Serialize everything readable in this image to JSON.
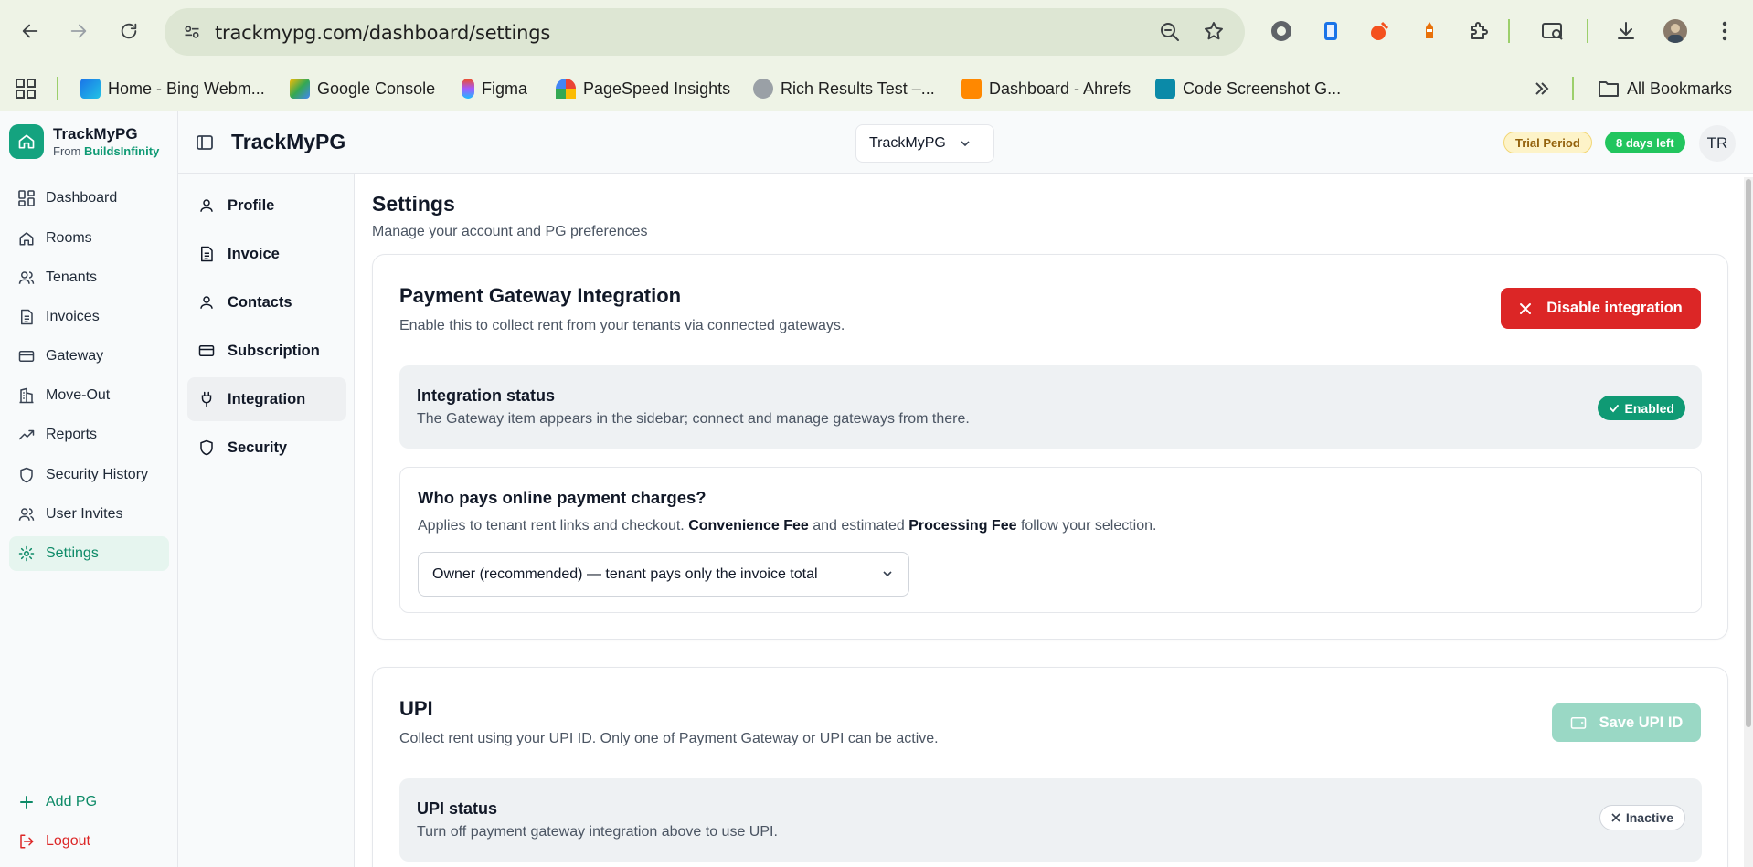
{
  "browser": {
    "url": "trackmypg.com/dashboard/settings",
    "bookmarks": [
      {
        "label": "Home - Bing Webm...",
        "color": "#1a73e8"
      },
      {
        "label": "Google Console",
        "color": "#fbbc04"
      },
      {
        "label": "Figma",
        "color": "#f24e1e"
      },
      {
        "label": "PageSpeed Insights",
        "color": "#4285f4"
      },
      {
        "label": "Rich Results Test –...",
        "color": "#5f6368"
      },
      {
        "label": "Dashboard - Ahrefs",
        "color": "#ff8800"
      },
      {
        "label": "Code Screenshot G...",
        "color": "#0b8aa8"
      }
    ],
    "all_bookmarks_label": "All Bookmarks"
  },
  "brand": {
    "name": "TrackMyPG",
    "from": "From",
    "company": "BuildsInfinity"
  },
  "sidebar": {
    "items": [
      {
        "label": "Dashboard",
        "icon": "grid-icon"
      },
      {
        "label": "Rooms",
        "icon": "home-icon"
      },
      {
        "label": "Tenants",
        "icon": "users-icon"
      },
      {
        "label": "Invoices",
        "icon": "file-icon"
      },
      {
        "label": "Gateway",
        "icon": "card-icon"
      },
      {
        "label": "Move-Out",
        "icon": "building-icon"
      },
      {
        "label": "Reports",
        "icon": "trend-icon"
      },
      {
        "label": "Security History",
        "icon": "shield-icon"
      },
      {
        "label": "User Invites",
        "icon": "users-icon"
      },
      {
        "label": "Settings",
        "icon": "gear-icon"
      }
    ],
    "add_pg": "Add PG",
    "logout": "Logout"
  },
  "topbar": {
    "title": "TrackMyPG",
    "pg_select": "TrackMyPG",
    "trial_badge": "Trial Period",
    "days_badge": "8 days left",
    "avatar": "TR"
  },
  "settings_nav": {
    "items": [
      {
        "label": "Profile",
        "icon": "user-icon"
      },
      {
        "label": "Invoice",
        "icon": "file-icon"
      },
      {
        "label": "Contacts",
        "icon": "user-icon"
      },
      {
        "label": "Subscription",
        "icon": "card-icon"
      },
      {
        "label": "Integration",
        "icon": "plug-icon"
      },
      {
        "label": "Security",
        "icon": "shield-icon"
      }
    ]
  },
  "main": {
    "title": "Settings",
    "subtitle": "Manage your account and PG preferences",
    "gateway_card": {
      "title": "Payment Gateway Integration",
      "subtitle": "Enable this to collect rent from your tenants via connected gateways.",
      "disable_button": "Disable integration",
      "status_title": "Integration status",
      "status_sub": "The Gateway item appears in the sidebar; connect and manage gateways from there.",
      "status_badge": "Enabled",
      "who_title": "Who pays online payment charges?",
      "who_sub_1": "Applies to tenant rent links and checkout.",
      "who_sub_bold_1": "Convenience Fee",
      "who_sub_2": "and estimated",
      "who_sub_bold_2": "Processing Fee",
      "who_sub_3": "follow your selection.",
      "who_select": "Owner (recommended) — tenant pays only the invoice total"
    },
    "upi_card": {
      "title": "UPI",
      "subtitle": "Collect rent using your UPI ID. Only one of Payment Gateway or UPI can be active.",
      "save_button": "Save UPI ID",
      "status_title": "UPI status",
      "status_sub": "Turn off payment gateway integration above to use UPI.",
      "status_badge": "Inactive"
    }
  },
  "colors": {
    "accent": "#0f9a74",
    "danger": "#dc2626",
    "save_disabled": "#9ad8c5",
    "success_badge": "#22c55e",
    "trial_badge_bg": "#fdf3c8"
  }
}
